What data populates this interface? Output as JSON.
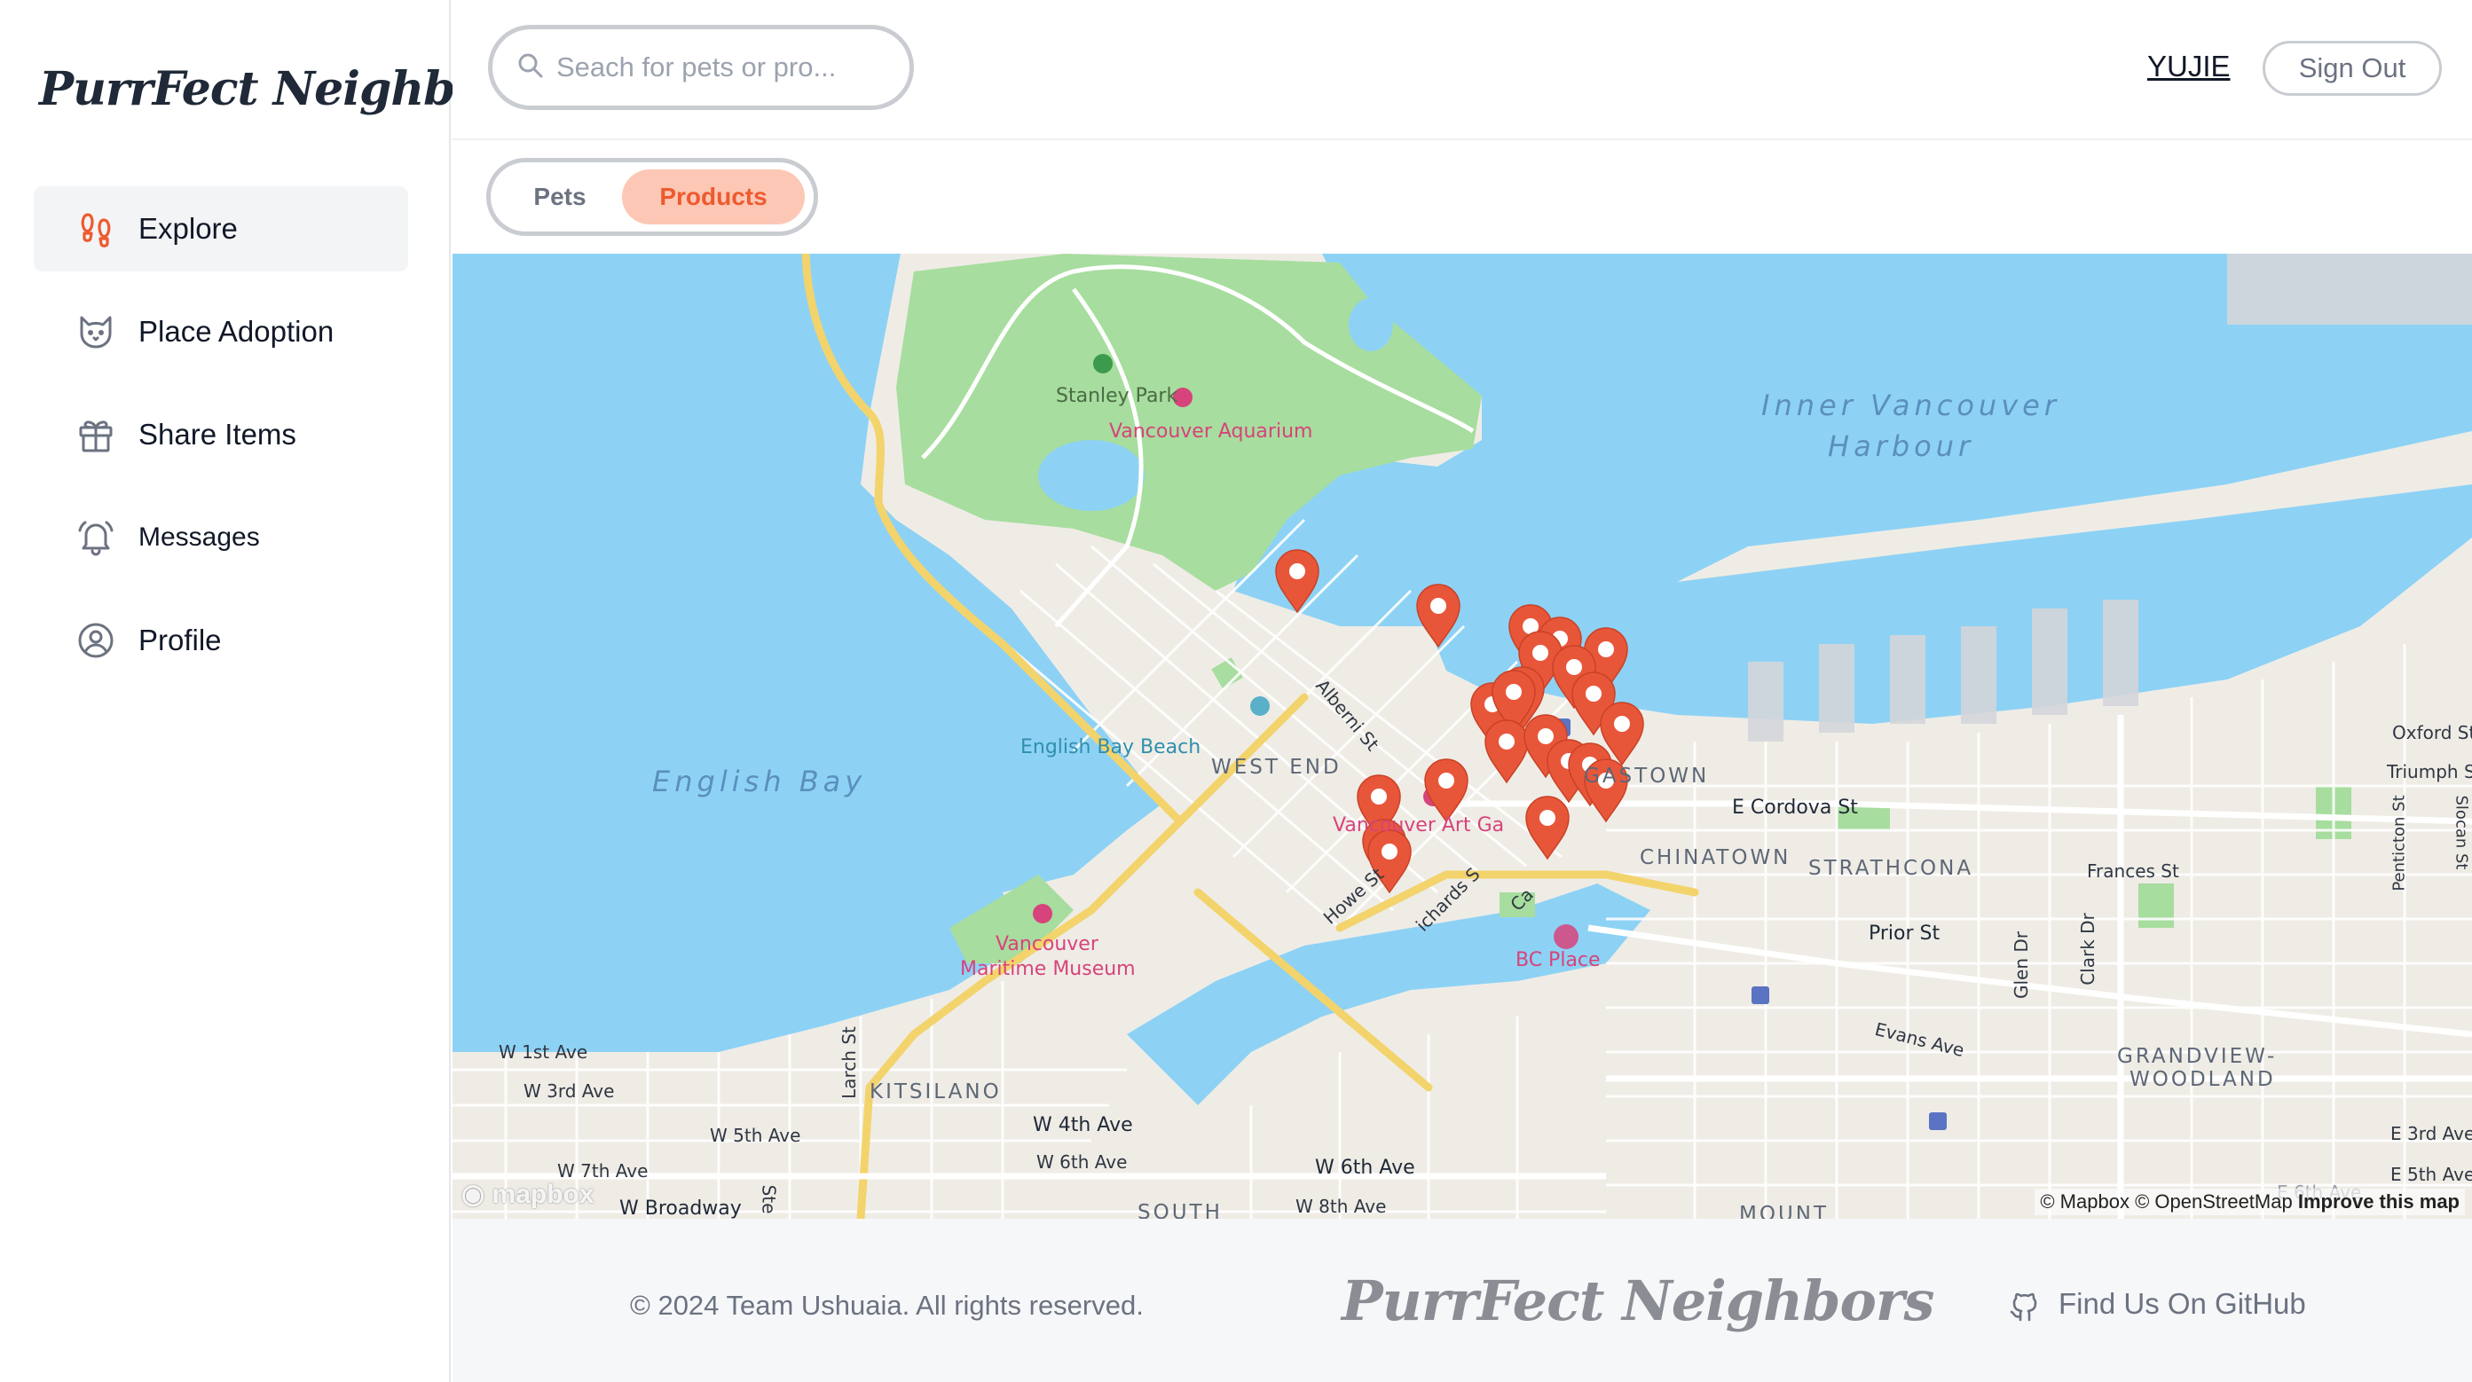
{
  "app": {
    "logo": "PurrFect Neighbors"
  },
  "sidebar": {
    "items": [
      {
        "label": "Explore",
        "icon": "footprints-icon",
        "active": true
      },
      {
        "label": "Place Adoption",
        "icon": "cat-icon"
      },
      {
        "label": "Share Items",
        "icon": "gift-icon"
      },
      {
        "label": "Messages",
        "icon": "bell-icon"
      },
      {
        "label": "Profile",
        "icon": "user-circle-icon"
      }
    ]
  },
  "header": {
    "search_placeholder": "Seach for pets or pro...",
    "username": "YUJIE",
    "signout_label": "Sign Out"
  },
  "toggle": {
    "pets_label": "Pets",
    "products_label": "Products",
    "selected": "Products"
  },
  "map": {
    "water_labels": {
      "harbour_1": "Inner Vancouver",
      "harbour_2": "Harbour",
      "bay": "English Bay"
    },
    "pois": {
      "stanley_park": "Stanley Park",
      "aquarium": "Vancouver Aquarium",
      "beach": "English Bay Beach",
      "art_gallery": "Vancouver Art Ga",
      "maritime_1": "Vancouver",
      "maritime_2": "Maritime Museum",
      "bc_place": "BC Place"
    },
    "districts": {
      "west_end": "WEST END",
      "gastown": "GASTOWN",
      "chinatown": "CHINATOWN",
      "strathcona": "STRATHCONA",
      "kitsilano": "KITSILANO",
      "grandview_1": "GRANDVIEW-",
      "grandview_2": "WOODLAND",
      "south": "SOUTH",
      "mount": "MOUNT"
    },
    "streets": {
      "alberni": "Alberni St",
      "howe": "Howe St",
      "richards": "ichards S",
      "cambie": "Ca",
      "cordova": "E Cordova St",
      "oxford": "Oxford St",
      "triumph": "Triumph St",
      "frances": "Frances St",
      "prior": "Prior St",
      "evans": "Evans Ave",
      "glen": "Glen Dr",
      "clark": "Clark Dr",
      "penticton": "Penticton St",
      "slocan": "Slocan St",
      "w1st": "W 1st Ave",
      "w3rd": "W 3rd Ave",
      "w5th": "W 5th Ave",
      "w7th": "W 7th Ave",
      "wbroadway": "W Broadway",
      "larch": "Larch St",
      "w4th": "W 4th Ave",
      "w6th_a": "W 6th Ave",
      "w6th_b": "W 6th Ave",
      "w8th": "W 8th Ave",
      "e3rd": "E 3rd Ave",
      "e5th": "E 5th Ave",
      "e6th": "E 6th Ave",
      "ste": "Ste"
    },
    "attribution": {
      "mapbox": "© Mapbox",
      "osm": "© OpenStreetMap",
      "improve": "Improve this map"
    },
    "logo_text": "mapbox",
    "marker_count": 22,
    "colors": {
      "marker": "#e8563a",
      "water": "#8dd2f5",
      "park": "#a7dd9e",
      "land": "#f0ede8"
    }
  },
  "footer": {
    "copyright": "© 2024 Team Ushuaia. All rights reserved.",
    "logo": "PurrFect Neighbors",
    "github_label": "Find Us On GitHub"
  }
}
